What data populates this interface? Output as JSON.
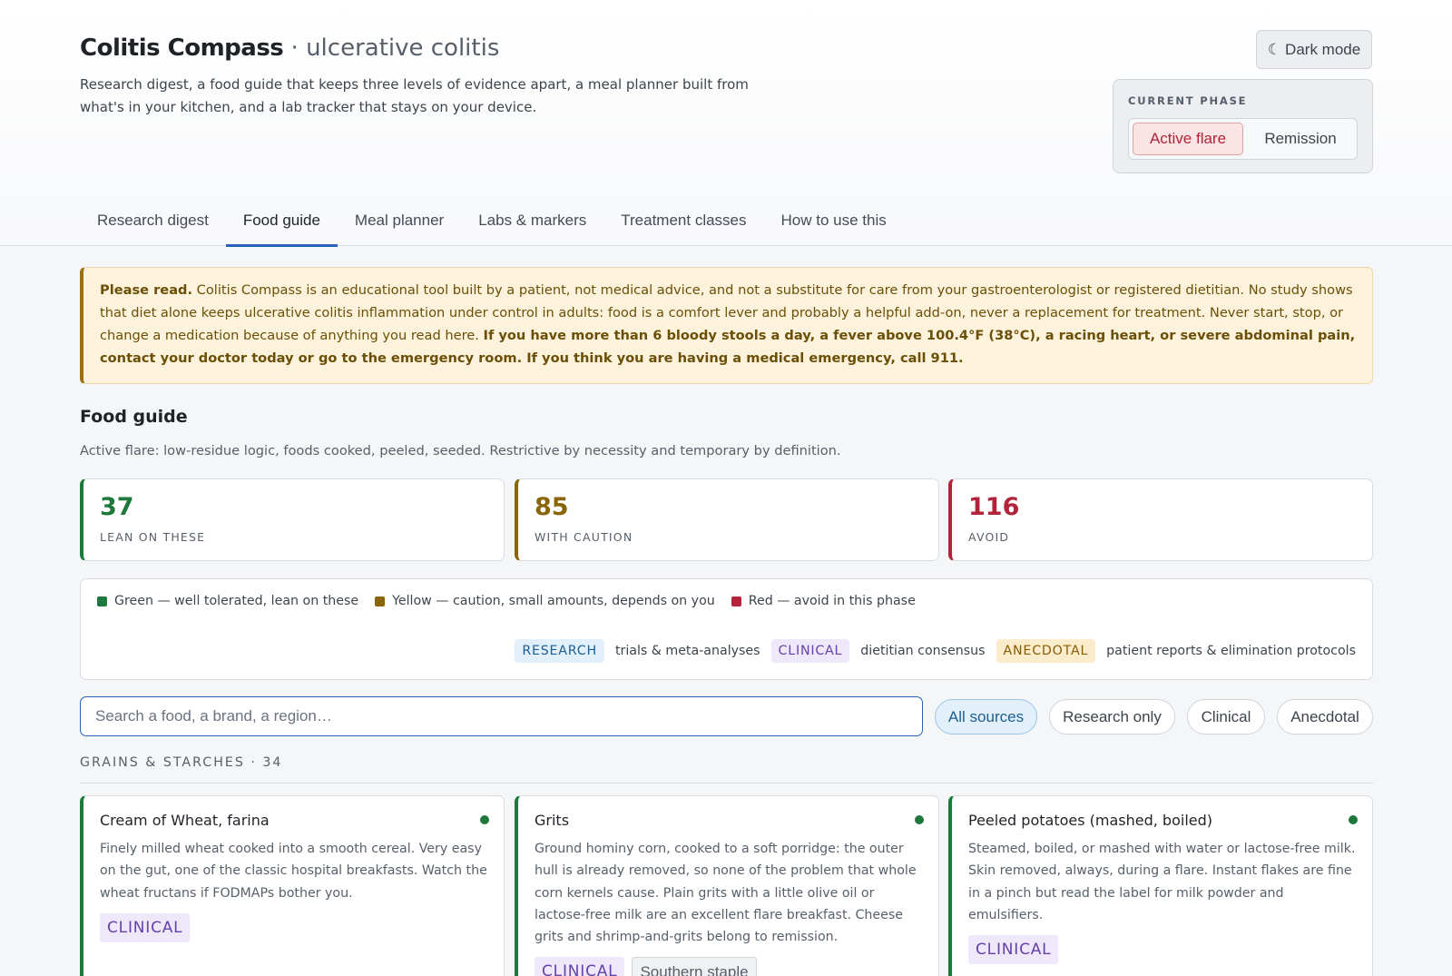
{
  "app": {
    "name": "Colitis Compass",
    "separator": " · ",
    "condition": "ulcerative colitis",
    "tagline": "Research digest, a food guide that keeps three levels of evidence apart, a meal planner built from what's in your kitchen, and a lab tracker that stays on your device.",
    "dark_mode_icon": "☾",
    "dark_mode_label": "Dark mode"
  },
  "phase": {
    "label": "CURRENT PHASE",
    "active_option": "Active flare",
    "other_option": "Remission"
  },
  "tabs": [
    {
      "label": "Research digest"
    },
    {
      "label": "Food guide"
    },
    {
      "label": "Meal planner"
    },
    {
      "label": "Labs & markers"
    },
    {
      "label": "Treatment classes"
    },
    {
      "label": "How to use this"
    }
  ],
  "notice": {
    "lead": "Please read.",
    "body": " Colitis Compass is an educational tool built by a patient, not medical advice, and not a substitute for care from your gastroenterologist or registered dietitian. No study shows that diet alone keeps ulcerative colitis inflammation under control in adults: food is a comfort lever and probably a helpful add-on, never a replacement for treatment. Never start, stop, or change a medication because of anything you read here. ",
    "warning": "If you have more than 6 bloody stools a day, a fever above 100.4°F (38°C), a racing heart, or severe abdominal pain, contact your doctor today or go to the emergency room. If you think you are having a medical emergency, call 911."
  },
  "section": {
    "title": "Food guide",
    "description": "Active flare: low-residue logic, foods cooked, peeled, seeded. Restrictive by necessity and temporary by definition."
  },
  "stats": [
    {
      "value": "37",
      "label": "LEAN ON THESE",
      "color": "#1e7a3c"
    },
    {
      "value": "85",
      "label": "WITH CAUTION",
      "color": "#8a6508"
    },
    {
      "value": "116",
      "label": "AVOID",
      "color": "#b3243a"
    }
  ],
  "legend": {
    "colors": [
      {
        "text": "Green — well tolerated, lean on these",
        "color": "#1e7a3c"
      },
      {
        "text": "Yellow — caution, small amounts, depends on you",
        "color": "#8a6508"
      },
      {
        "text": "Red — avoid in this phase",
        "color": "#b3243a"
      }
    ],
    "sources": [
      {
        "tag": "RESEARCH",
        "text": "trials & meta-analyses"
      },
      {
        "tag": "CLINICAL",
        "text": "dietitian consensus"
      },
      {
        "tag": "ANECDOTAL",
        "text": "patient reports & elimination protocols"
      }
    ]
  },
  "search": {
    "placeholder": "Search a food, a brand, a region…"
  },
  "filters": [
    {
      "label": "All sources"
    },
    {
      "label": "Research only"
    },
    {
      "label": "Clinical"
    },
    {
      "label": "Anecdotal"
    }
  ],
  "group": {
    "header": "GRAINS & STARCHES · 34"
  },
  "cards": [
    {
      "title": "Cream of Wheat, farina",
      "description": "Finely milled wheat cooked into a smooth cereal. Very easy on the gut, one of the classic hospital breakfasts. Watch the wheat fructans if FODMAPs bother you.",
      "tags": [
        "CLINICAL"
      ]
    },
    {
      "title": "Grits",
      "description": "Ground hominy corn, cooked to a soft porridge: the outer hull is already removed, so none of the problem that whole corn kernels cause. Plain grits with a little olive oil or lactose-free milk are an excellent flare breakfast. Cheese grits and shrimp-and-grits belong to remission.",
      "tags": [
        "CLINICAL",
        "Southern staple"
      ]
    },
    {
      "title": "Peeled potatoes (mashed, boiled)",
      "description": "Steamed, boiled, or mashed with water or lactose-free milk. Skin removed, always, during a flare. Instant flakes are fine in a pinch but read the label for milk powder and emulsifiers.",
      "tags": [
        "CLINICAL"
      ]
    }
  ]
}
